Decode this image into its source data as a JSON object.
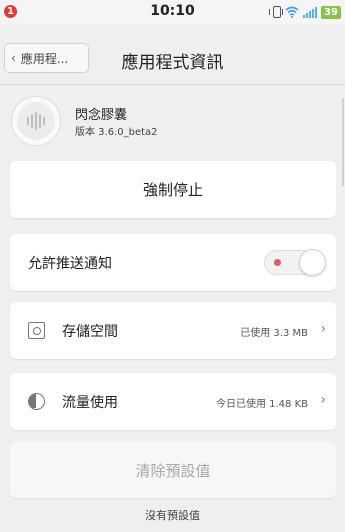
{
  "status_bar": {
    "notification_count": "1",
    "time": "10:10",
    "battery": "39",
    "icons": [
      "vibrate-icon",
      "wifi-icon",
      "signal-icon",
      "battery-icon"
    ],
    "wifi_color": "#3aa0e6",
    "battery_color": "#8bc34a"
  },
  "header": {
    "back_label": "應用程...",
    "title": "應用程式資訊"
  },
  "app": {
    "name": "閃念膠囊",
    "version": "版本 3.6.0_beta2"
  },
  "actions": {
    "force_stop": "強制停止"
  },
  "notification": {
    "label": "允許推送通知",
    "enabled": true,
    "accent": "#e0586b"
  },
  "storage": {
    "label": "存儲空間",
    "value": "已使用 3.3 MB"
  },
  "traffic": {
    "label": "流量使用",
    "value": "今日已使用 1.48 KB"
  },
  "defaults": {
    "clear_label": "清除預設值",
    "note": "沒有預設值"
  }
}
